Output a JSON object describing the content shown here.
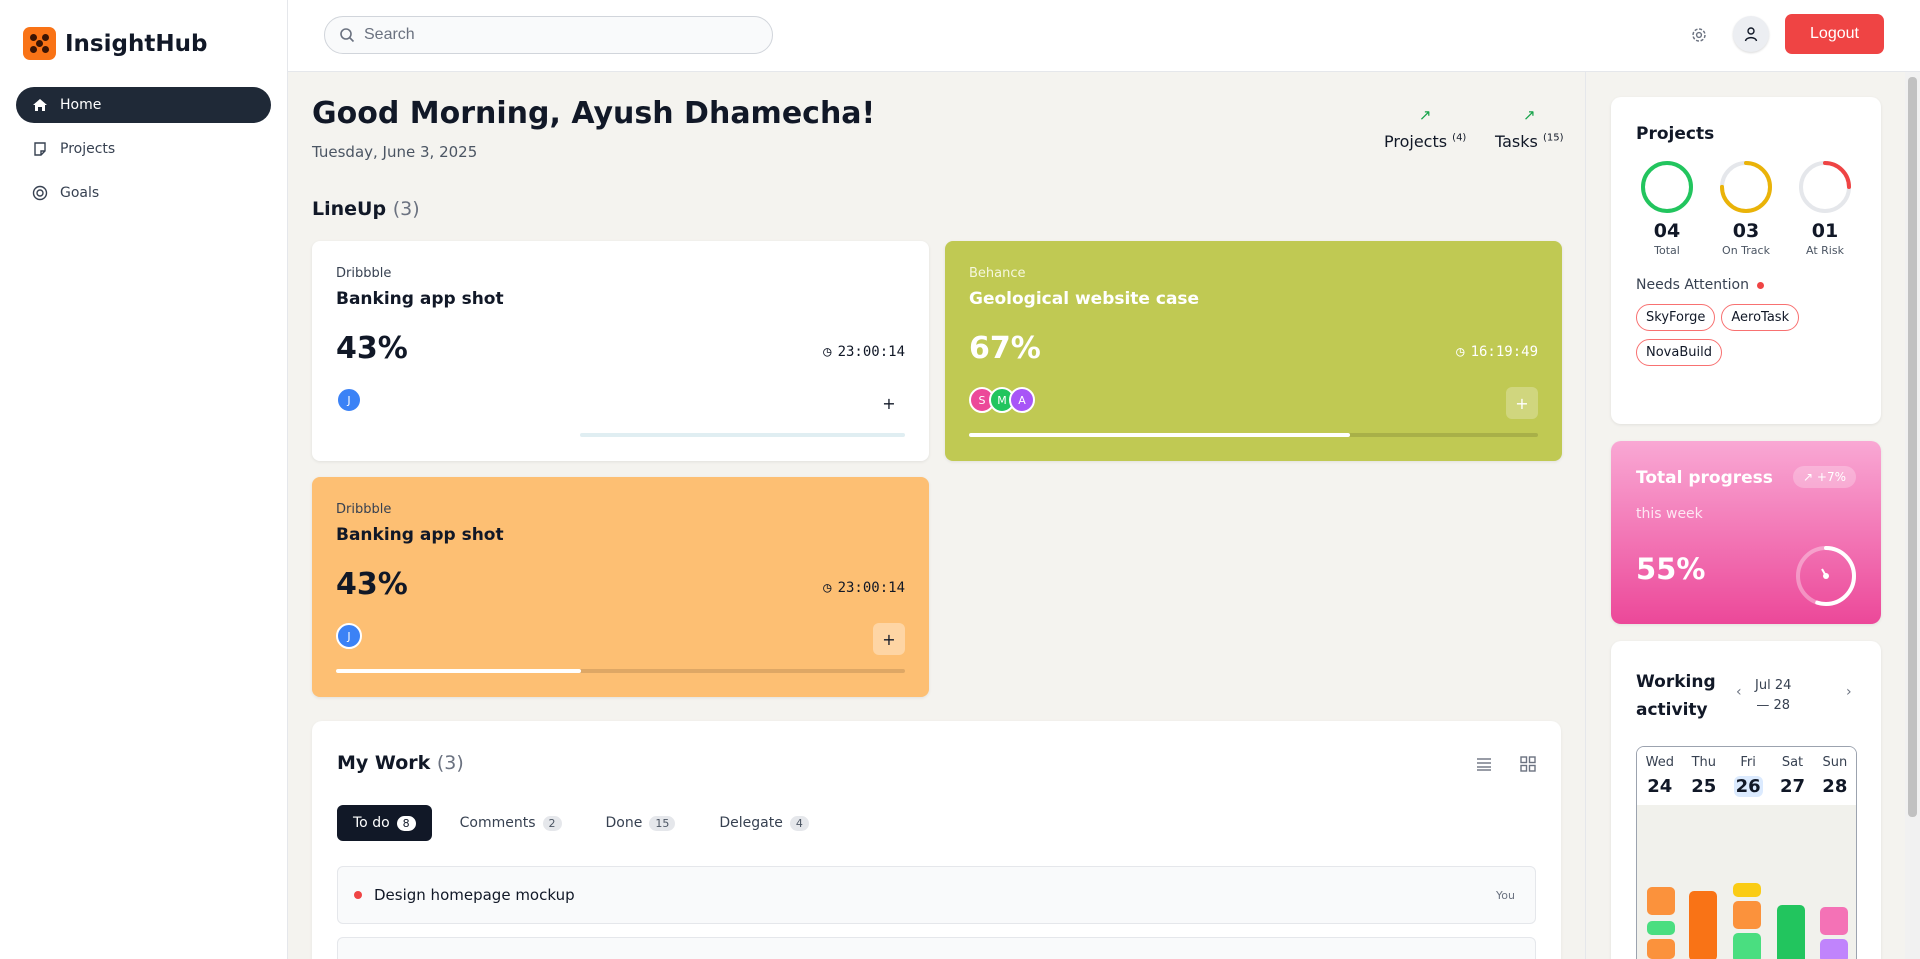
{
  "app": {
    "name": "InsightHub"
  },
  "sidebar": {
    "items": [
      {
        "label": "Home",
        "icon": "home-icon",
        "active": true
      },
      {
        "label": "Projects",
        "icon": "note-icon",
        "active": false
      },
      {
        "label": "Goals",
        "icon": "target-icon",
        "active": false
      }
    ]
  },
  "header": {
    "search_placeholder": "Search",
    "logout_label": "Logout"
  },
  "greeting": {
    "title": "Good Morning, Ayush Dhamecha!",
    "date": "Tuesday, June 3, 2025"
  },
  "stats": [
    {
      "label": "Projects",
      "count": "(4)"
    },
    {
      "label": "Tasks",
      "count": "(15)"
    }
  ],
  "lineup": {
    "title": "LineUp",
    "count": "(3)",
    "cards": [
      {
        "source": "Dribbble",
        "title": "Banking app shot",
        "percent": "43%",
        "progress": 0.43,
        "timer": "23:00:14",
        "avatars": [
          "J"
        ],
        "bg": "#ffffff"
      },
      {
        "source": "Behance",
        "title": "Geological website case",
        "percent": "67%",
        "progress": 0.67,
        "timer": "16:19:49",
        "avatars": [
          "S",
          "M",
          "A"
        ],
        "bg": "#c0c953"
      },
      {
        "source": "Dribbble",
        "title": "Banking app shot",
        "percent": "43%",
        "progress": 0.43,
        "timer": "23:00:14",
        "avatars": [
          "J"
        ],
        "bg": "#fdbf73"
      }
    ]
  },
  "mywork": {
    "title": "My Work",
    "count": "(3)",
    "tabs": [
      {
        "label": "To do",
        "count": "8",
        "active": true
      },
      {
        "label": "Comments",
        "count": "2",
        "active": false
      },
      {
        "label": "Done",
        "count": "15",
        "active": false
      },
      {
        "label": "Delegate",
        "count": "4",
        "active": false
      }
    ],
    "tasks": [
      {
        "title": "Design homepage mockup",
        "owner": "You"
      }
    ]
  },
  "projects_panel": {
    "title": "Projects",
    "rings": [
      {
        "value": "04",
        "label": "Total",
        "fraction": 1.0,
        "color": "#22c55e"
      },
      {
        "value": "03",
        "label": "On Track",
        "fraction": 0.75,
        "color": "#eab308"
      },
      {
        "value": "01",
        "label": "At Risk",
        "fraction": 0.25,
        "color": "#ef4444"
      }
    ],
    "needs_attention_label": "Needs Attention",
    "chips": [
      "SkyForge",
      "AeroTask",
      "NovaBuild"
    ]
  },
  "progress_panel": {
    "title": "Total progress",
    "badge": "+7%",
    "subtitle": "this week",
    "value": "55%",
    "fraction": 0.55
  },
  "activity_panel": {
    "title_line1": "Working",
    "title_line2": "activity",
    "range_line1": "Jul 24",
    "range_line2": "— 28",
    "days": [
      {
        "day": "Wed",
        "date": "24",
        "selected": false
      },
      {
        "day": "Thu",
        "date": "25",
        "selected": false
      },
      {
        "day": "Fri",
        "date": "26",
        "selected": true
      },
      {
        "day": "Sat",
        "date": "27",
        "selected": false
      },
      {
        "day": "Sun",
        "date": "28",
        "selected": false
      }
    ]
  },
  "colors": {
    "accent": "#ef4444",
    "dark": "#1f2937",
    "green": "#22c55e",
    "pink": "#ec4899"
  }
}
